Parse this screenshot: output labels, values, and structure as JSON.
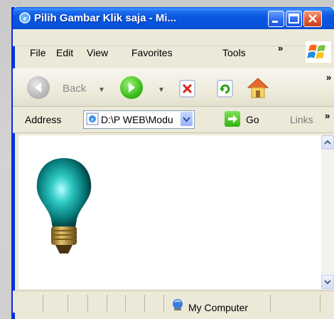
{
  "window": {
    "title": "Pilih Gambar Klik saja - Mi...",
    "accent_color": "#0a56e0"
  },
  "menu": {
    "items": [
      "File",
      "Edit",
      "View",
      "Favorites",
      "Tools"
    ],
    "overflow": "»"
  },
  "toolbar": {
    "back_label": "Back",
    "buttons": [
      "back-icon",
      "forward-icon",
      "stop-icon",
      "refresh-icon",
      "home-icon"
    ],
    "overflow": "»"
  },
  "address": {
    "label": "Address",
    "value": "D:\\P WEB\\Modu",
    "go_label": "Go",
    "links_label": "Links",
    "links_overflow": "»"
  },
  "content": {
    "image": "lightbulb-icon"
  },
  "status": {
    "zone_text": "My Computer"
  }
}
